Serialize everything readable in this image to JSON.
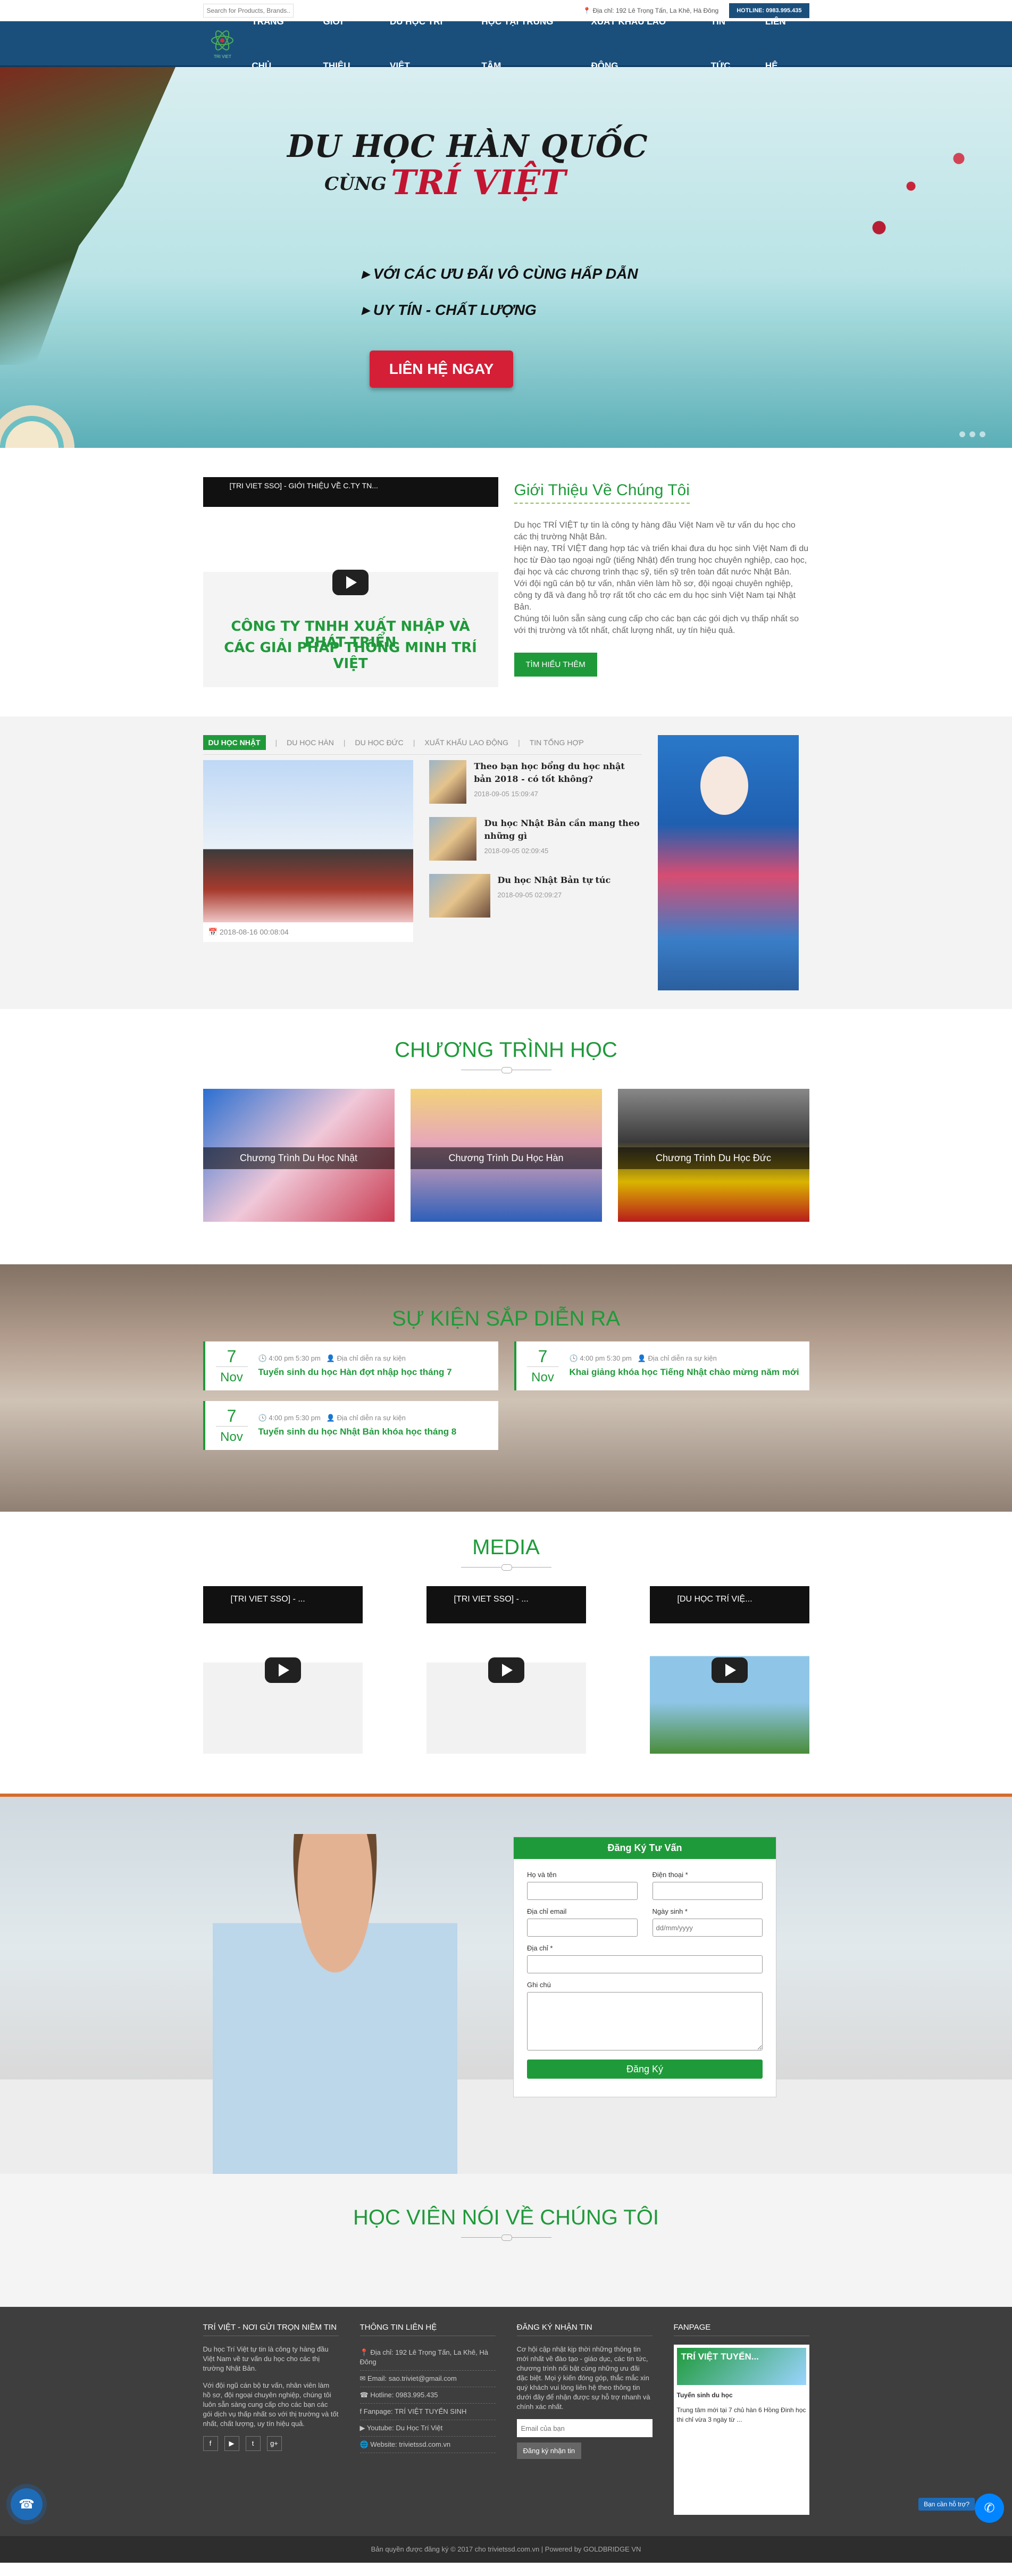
{
  "topbar": {
    "search_placeholder": "Search for Products, Brands...",
    "address": "Địa chỉ: 192 Lê Trọng Tấn, La Khê, Hà Đông",
    "hotline": "HOTLINE: 0983.995.435"
  },
  "logo": {
    "text": "TRI VIET"
  },
  "nav": [
    "TRANG CHỦ",
    "GIỚI THIỆU",
    "DU HỌC TRÍ VIỆT",
    "HỌC TẠI TRUNG TÂM",
    "XUẤT KHẨU LAO ĐỘNG",
    "TIN TỨC",
    "LIÊN HỆ"
  ],
  "hero": {
    "title": "DU HỌC HÀN QUỐC",
    "cung": "CÙNG",
    "brand": "TRÍ VIỆT",
    "bullet1": "VỚI CÁC ƯU ĐÃI VÔ CÙNG HẤP DẪN",
    "bullet2": "UY TÍN - CHẤT LƯỢNG",
    "cta": "LIÊN HỆ NGAY"
  },
  "intro": {
    "video_title": "[TRI VIET SSO] - GIỚI THIỆU VỀ C.TY TN...",
    "video_line1": "CÔNG TY TNHH XUẤT NHẬP VÀ PHÁT TRIỂN",
    "video_line2": "CÁC GIẢI PHÁP THÔNG MINH TRÍ VIỆT",
    "heading": "Giới Thiệu Về Chúng Tôi",
    "p1": "Du học TRÍ VIỆT tự tin là công ty hàng đầu Việt Nam về tư vấn du học cho các thị trường Nhật Bản.",
    "p2": "Hiện nay, TRÍ VIỆT đang hợp tác và triển khai đưa du học sinh Việt Nam đi du học từ Đào tạo ngoại ngữ (tiếng Nhật) đến trung học chuyên nghiệp, cao học, đại học và các chương trình thạc sỹ, tiến sỹ trên toàn đất nước Nhật Bản.",
    "p3": "Với đội ngũ cán bộ tư vấn, nhân viên làm hồ sơ, đội ngoại chuyên nghiệp, công ty đã và đang hỗ trợ rất tốt cho các em du học sinh Việt Nam tại Nhật Bản.",
    "p4": "Chúng tôi luôn sẵn sàng cung cấp cho các bạn các gói dịch vụ thấp nhất so với thị trường và tốt nhất, chất lượng nhất, uy tín hiệu quả.",
    "button": "TÌM HIỂU THÊM"
  },
  "news": {
    "tabs": [
      "DU HỌC NHẬT",
      "DU HỌC HÀN",
      "DU HỌC ĐỨC",
      "XUẤT KHẨU LAO ĐỘNG",
      "TIN TỔNG HỢP"
    ],
    "featured_date": "2018-08-16 00:08:04",
    "items": [
      {
        "title": "Theo bạn học bổng du học nhật bản 2018 - có tốt không?",
        "date": "2018-09-05 15:09:47"
      },
      {
        "title": "Du học Nhật Bản cần mang theo những gì",
        "date": "2018-09-05 02:09:45"
      },
      {
        "title": "Du học Nhật Bản tự túc",
        "date": "2018-09-05 02:09:27"
      }
    ]
  },
  "programs": {
    "title": "CHƯƠNG TRÌNH HỌC",
    "items": [
      "Chương Trình Du Học Nhật",
      "Chương Trình Du Học Hàn",
      "Chương Trình Du Học Đức"
    ]
  },
  "events": {
    "title": "SỰ KIỆN SẮP DIỄN RA",
    "items": [
      {
        "day": "7",
        "month": "Nov",
        "time": "4:00 pm 5:30 pm",
        "place": "Địa chỉ diễn ra sự kiện",
        "title": "Tuyển sinh du học Hàn đợt nhập học tháng 7"
      },
      {
        "day": "7",
        "month": "Nov",
        "time": "4:00 pm 5:30 pm",
        "place": "Địa chỉ diễn ra sự kiện",
        "title": "Khai giảng khóa học Tiếng Nhật chào mừng năm mới"
      },
      {
        "day": "7",
        "month": "Nov",
        "time": "4:00 pm 5:30 pm",
        "place": "Địa chỉ diễn ra sự kiện",
        "title": "Tuyển sinh du học Nhật Bản khóa học tháng 8"
      }
    ]
  },
  "media": {
    "title": "MEDIA",
    "videos": [
      "[TRI VIET SSO] - ...",
      "[TRI VIET SSO] - ...",
      "[DU HỌC TRÍ VIỆ..."
    ]
  },
  "form": {
    "title": "Đăng Ký Tư Vấn",
    "name": "Họ và tên",
    "phone": "Điện thoại *",
    "email": "Địa chỉ email",
    "date": "Ngày sinh *",
    "date_placeholder": "dd/mm/yyyy",
    "address": "Địa chỉ *",
    "note": "Ghi chú",
    "submit": "Đăng Ký"
  },
  "testimonials": {
    "title": "HỌC VIÊN NÓI VỀ CHÚNG TÔI"
  },
  "footer": {
    "col1_title": "TRÍ VIỆT - NƠI GỬI TRỌN NIỀM TIN",
    "col1_p1": "Du học Trí Việt tự tin là công ty hàng đầu Việt Nam về tư vấn du học cho các thị trường Nhật Bản.",
    "col1_p2": "Với đội ngũ cán bộ tư vấn, nhân viên làm hồ sơ, đội ngoại chuyên nghiệp, chúng tôi luôn sẵn sàng cung cấp cho các bạn các gói dịch vụ thấp nhất so với thị trường và tốt nhất, chất lượng, uy tín hiệu quả.",
    "col2_title": "THÔNG TIN LIÊN HỆ",
    "contacts": [
      "Địa chỉ: 192 Lê Trọng Tấn, La Khê, Hà Đông",
      "Email: sao.triviet@gmail.com",
      "Hotline: 0983.995.435",
      "Fanpage: TRÍ VIỆT TUYỂN SINH",
      "Youtube: Du Học Trí Việt",
      "Website: trivietssd.com.vn"
    ],
    "col3_title": "ĐĂNG KÝ NHẬN TIN",
    "col3_p": "Cơ hội cập nhật kịp thời những thông tin mới nhất về đào tạo - giáo dục, các tin tức, chương trình nổi bật cùng những ưu đãi đặc biệt. Mọi ý kiến đóng góp, thắc mắc xin quý khách vui lòng liên hệ theo thông tin dưới đây để nhận được sự hỗ trợ nhanh và chính xác nhất.",
    "email_placeholder": "Email của bạn",
    "subscribe": "Đăng ký nhận tin",
    "col4_title": "FANPAGE",
    "fanpage_name": "TRÍ VIỆT TUYỂN...",
    "fanpage_sub": "Tuyển sinh du học",
    "fanpage_post": "Trung tâm mới tại 7 chủ hàn 6 Hồng Đinh học thi chỉ vừa 3 ngày từ ...",
    "copyright": "Bản quyền được đăng ký © 2017 cho trivietssd.com.vn | Powered by GOLDBRIDGE VN",
    "chat": "Bạn cần hỗ trợ?"
  }
}
